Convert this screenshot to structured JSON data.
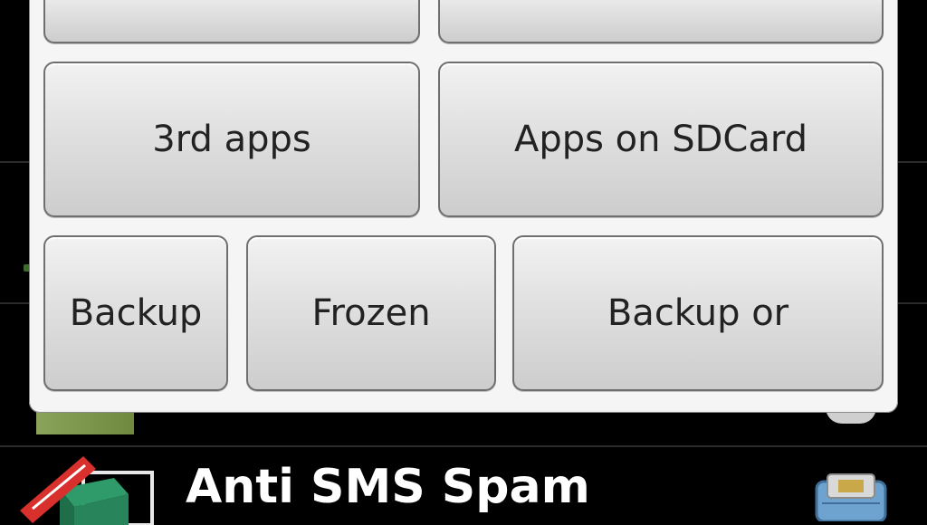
{
  "dialog": {
    "buttons": {
      "third_apps": "3rd apps",
      "apps_on_sdcard": "Apps on SDCard",
      "backup": "Backup",
      "frozen": "Frozen",
      "backup_or": "Backup or"
    }
  },
  "list": {
    "item_title": "Anti SMS Spam"
  },
  "icons": {
    "app_icon": "app-icon-free-sms",
    "right_icon": "backup-storage-icon"
  }
}
